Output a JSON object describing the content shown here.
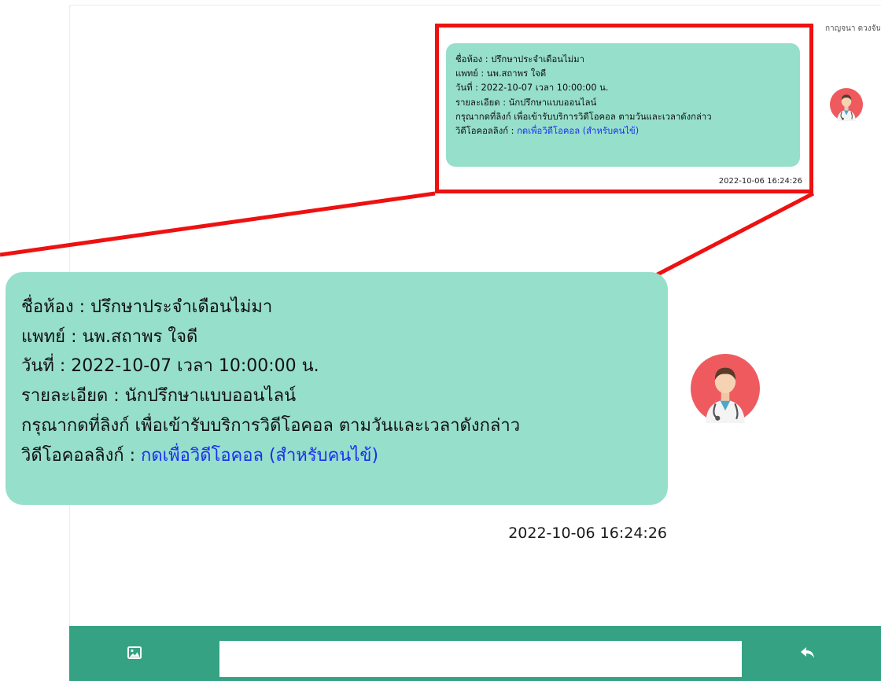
{
  "chat": {
    "top_sender": "กาญจนา ดวงจันทร์",
    "message": {
      "room_label": "ชื่อห้อง : ปรึกษาประจำเดือนไม่มา",
      "doctor_label": "แพทย์ : นพ.สถาพร ใจดี",
      "date_label": "วันที่ : 2022-10-07 เวลา 10:00:00 น.",
      "detail_label": "รายละเอียด : นักปรึกษาแบบออนไลน์",
      "instruction": "กรุณากดที่ลิงก์ เพื่อเข้ารับบริการวิดีโอคอล ตามวันและเวลาดังกล่าว",
      "video_prefix": "วิดีโอคอลลิงก์ : ",
      "video_link": "กดเพื่อวิดีโอคอล (สำหรับคนไข้)",
      "timestamp": "2022-10-06 16:24:26"
    }
  },
  "footer": {
    "input_value": "",
    "input_placeholder": "",
    "image_icon": "image-icon",
    "reply_icon": "reply-arrow-icon"
  },
  "colors": {
    "bubble": "#96dfcb",
    "highlight": "#ee1111",
    "footer": "#35a283",
    "link": "#1a2ef2",
    "avatar_bg": "#ef5a5f"
  }
}
